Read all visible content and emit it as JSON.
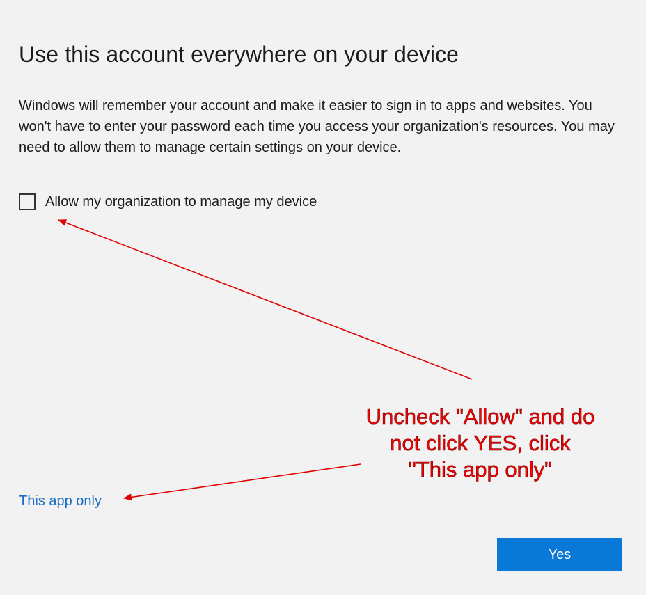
{
  "dialog": {
    "title": "Use this account everywhere on your device",
    "body": "Windows will remember your account and make it easier to sign in to apps and websites. You won't have to enter your password each time you access your organization's resources. You may need to allow them to manage certain settings on your device.",
    "checkbox": {
      "label": "Allow my organization to manage my device",
      "checked": false
    },
    "link_label": "This app only",
    "yes_label": "Yes"
  },
  "annotation": {
    "lines": [
      "Uncheck \"Allow\" and do",
      "not click YES, click",
      "\"This app only\""
    ],
    "color": "#ff0000"
  },
  "colors": {
    "background": "#f2f2f2",
    "link": "#1a6fc4",
    "primary_button": "#0a78d7"
  }
}
